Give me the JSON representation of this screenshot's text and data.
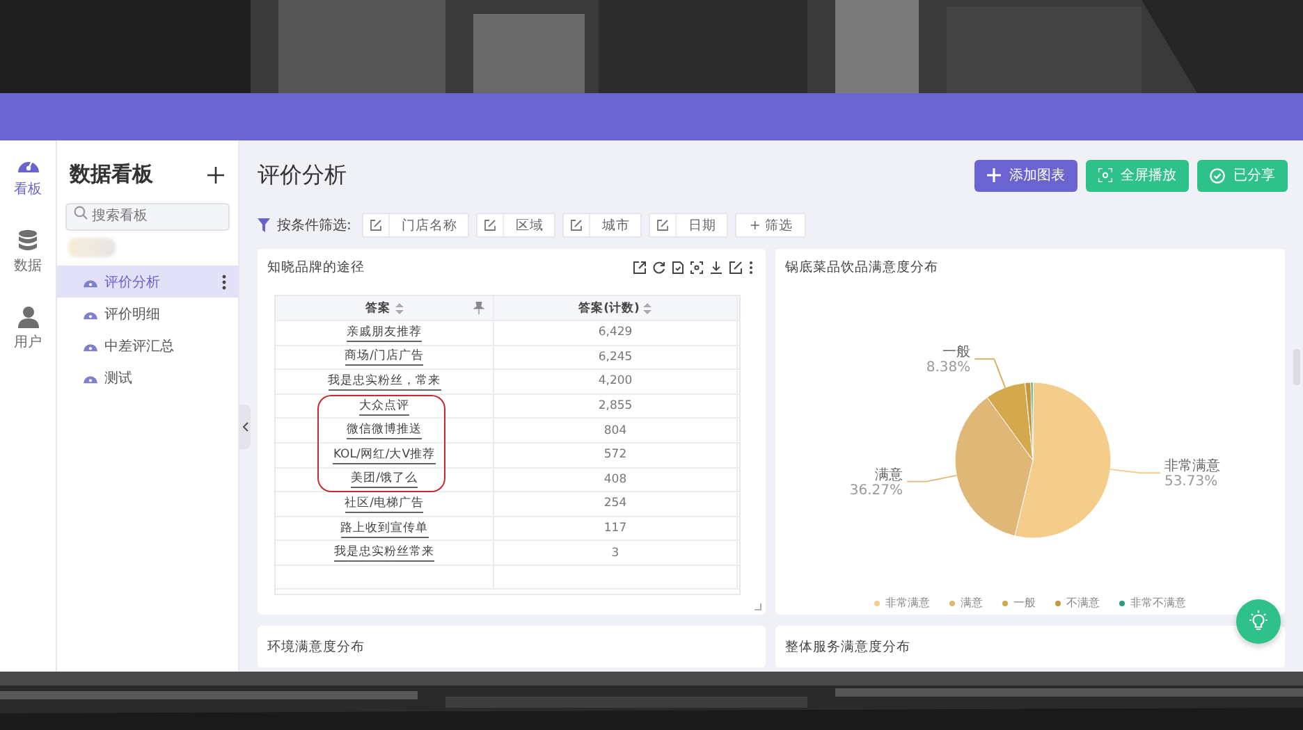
{
  "rail": [
    {
      "label": "看板",
      "kind": "dashboard",
      "selected": true
    },
    {
      "label": "数据",
      "kind": "database",
      "selected": false
    },
    {
      "label": "用户",
      "kind": "user",
      "selected": false
    }
  ],
  "sidebar": {
    "title": "数据看板",
    "search": {
      "placeholder": "搜索看板"
    },
    "items": [
      {
        "label": "评价分析",
        "selected": true
      },
      {
        "label": "评价明细",
        "selected": false
      },
      {
        "label": "中差评汇总",
        "selected": false
      },
      {
        "label": "测试",
        "selected": false
      }
    ]
  },
  "page": {
    "title": "评价分析",
    "buttons": [
      {
        "label": "添加图表",
        "kind": "add"
      },
      {
        "label": "全屏播放",
        "kind": "fullscreen"
      },
      {
        "label": "已分享",
        "kind": "shared"
      }
    ]
  },
  "filters": {
    "label": "按条件筛选:",
    "chips": [
      "门店名称",
      "区域",
      "城市",
      "日期"
    ],
    "add": "+ 筛选"
  },
  "panels": [
    {
      "title": "知晓品牌的途径",
      "table": {
        "columns": [
          "答案",
          "答案(计数)"
        ],
        "rows": [
          {
            "cells": [
              "亲戚朋友推荐",
              "6,429"
            ],
            "circled": false
          },
          {
            "cells": [
              "商场/门店广告",
              "6,245"
            ],
            "circled": false
          },
          {
            "cells": [
              "我是忠实粉丝，常来",
              "4,200"
            ],
            "circled": false
          },
          {
            "cells": [
              "大众点评",
              "2,855"
            ],
            "circled": true
          },
          {
            "cells": [
              "微信微博推送",
              "804"
            ],
            "circled": true
          },
          {
            "cells": [
              "KOL/网红/大V推荐",
              "572"
            ],
            "circled": true
          },
          {
            "cells": [
              "美团/饿了么",
              "408"
            ],
            "circled": true
          },
          {
            "cells": [
              "社区/电梯广告",
              "254"
            ],
            "circled": false
          },
          {
            "cells": [
              "路上收到宣传单",
              "117"
            ],
            "circled": false
          },
          {
            "cells": [
              "我是忠实粉丝常来",
              "3"
            ],
            "circled": false
          }
        ]
      }
    },
    {
      "title": "锅底菜品饮品满意度分布",
      "chart_data": {
        "type": "pie",
        "categories": [
          "非常满意",
          "满意",
          "一般",
          "不满意",
          "非常不满意"
        ],
        "values": [
          53.73,
          36.27,
          8.38,
          1.2,
          0.42
        ],
        "value_labels": [
          "53.73%",
          "36.27%",
          "8.38%",
          null,
          null
        ],
        "colors": [
          "#f5cd8a",
          "#dfb878",
          "#d4a84c",
          "#c8963c",
          "#2a9d7c"
        ]
      },
      "slice_labels": [
        "一般",
        "满意",
        "非常满意"
      ]
    },
    {
      "title": "环境满意度分布"
    },
    {
      "title": "整体服务满意度分布"
    }
  ]
}
